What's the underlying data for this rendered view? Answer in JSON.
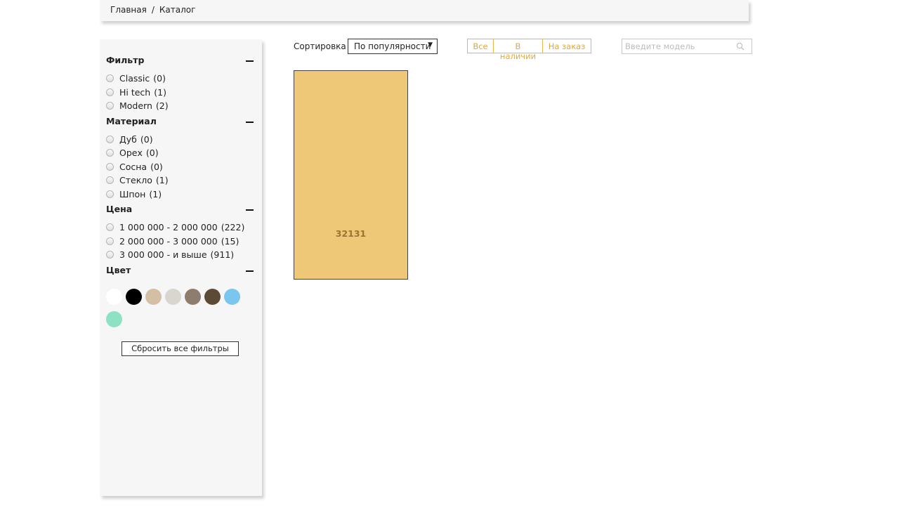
{
  "breadcrumb": {
    "home": "Главная",
    "separator": "/",
    "current": "Каталог"
  },
  "filters": {
    "style": {
      "title": "Фильтр",
      "options": [
        {
          "label": "Classic",
          "count": "(0)"
        },
        {
          "label": "Hi tech",
          "count": "(1)"
        },
        {
          "label": "Modern",
          "count": "(2)"
        }
      ]
    },
    "material": {
      "title": "Материал",
      "options": [
        {
          "label": "Дуб",
          "count": "(0)"
        },
        {
          "label": "Орех",
          "count": "(0)"
        },
        {
          "label": "Сосна",
          "count": "(0)"
        },
        {
          "label": "Стекло",
          "count": "(1)"
        },
        {
          "label": "Шпон",
          "count": "(1)"
        }
      ]
    },
    "price": {
      "title": "Цена",
      "options": [
        {
          "label": "1 000 000 - 2 000 000",
          "count": "(222)"
        },
        {
          "label": "2 000 000 - 3 000 000",
          "count": "(15)"
        },
        {
          "label": "3 000 000 - и выше",
          "count": "(911)"
        }
      ]
    },
    "color": {
      "title": "Цвет",
      "swatches": [
        "#ffffff",
        "#000000",
        "#d4bea4",
        "#d9d6cf",
        "#8e7c6e",
        "#5c4a36",
        "#79c6ef",
        "#8ee2c4"
      ]
    },
    "reset_label": "Сбросить все фильтры"
  },
  "toolbar": {
    "sort_label": "Сортировка",
    "sort_value": "По популярности",
    "sort_arrow": "▼",
    "availability": [
      "Все",
      "В наличии",
      "На заказ"
    ],
    "search_placeholder": "Введите модель"
  },
  "products": [
    {
      "model": "32131",
      "color": "#eec877"
    }
  ],
  "colors": {
    "panel_bg": "#f6f6f6",
    "accent": "#e0a93a"
  }
}
